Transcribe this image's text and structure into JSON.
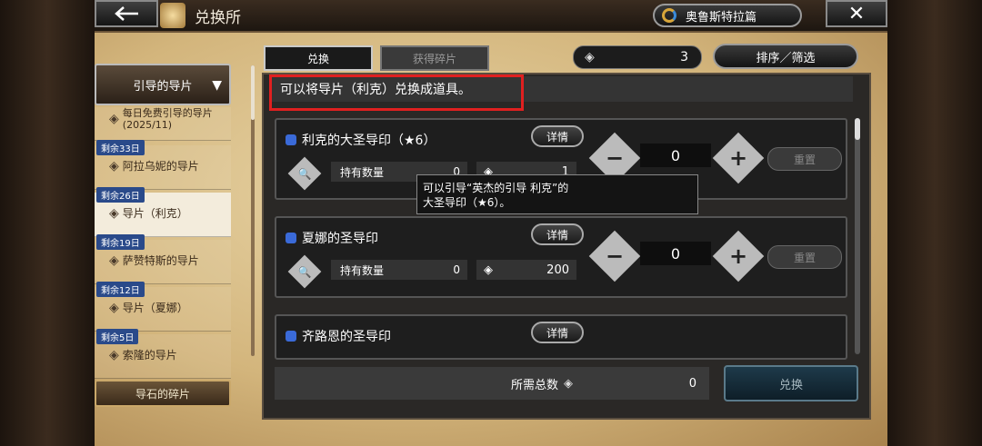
{
  "header": {
    "back_label": "←",
    "title": "兑换所",
    "world_label": "奥鲁斯特拉篇",
    "close_label": "✕"
  },
  "sidebar": {
    "category_label": "引导的导片",
    "items": [
      {
        "badge": "",
        "label": "每日免费引导的导片(2025/11)"
      },
      {
        "badge": "剩余33日",
        "label": "阿拉乌妮的导片"
      },
      {
        "badge": "剩余26日",
        "label": "导片（利克）"
      },
      {
        "badge": "剩余19日",
        "label": "萨赞特斯的导片"
      },
      {
        "badge": "剩余12日",
        "label": "导片（夏娜）"
      },
      {
        "badge": "剩余5日",
        "label": "索隆的导片"
      }
    ],
    "bottom_category_label": "导石的碎片"
  },
  "tabs": {
    "exchange": "兑换",
    "get_fragments": "获得碎片"
  },
  "currency": {
    "value": "3"
  },
  "sort_label": "排序／筛选",
  "info_text": "可以将导片（利克）兑换成道具。",
  "cards": [
    {
      "name": "利克的大圣导印（★6）",
      "detail": "详情",
      "hold_label": "持有数量",
      "hold": "0",
      "cost": "1",
      "qty": "0",
      "reset": "重置"
    },
    {
      "name": "夏娜的圣导印",
      "detail": "详情",
      "hold_label": "持有数量",
      "hold": "0",
      "cost": "200",
      "qty": "0",
      "reset": "重置"
    },
    {
      "name": "齐路恩的圣导印",
      "detail": "详情",
      "hold_label": "",
      "hold": "",
      "cost": "",
      "qty": "",
      "reset": ""
    }
  ],
  "tooltip": {
    "line1": "可以引导“英杰的引导 利克”的",
    "line2": "大圣导印（★6）。"
  },
  "footer": {
    "total_label": "所需总数",
    "total_value": "0",
    "exchange_label": "兑换"
  }
}
